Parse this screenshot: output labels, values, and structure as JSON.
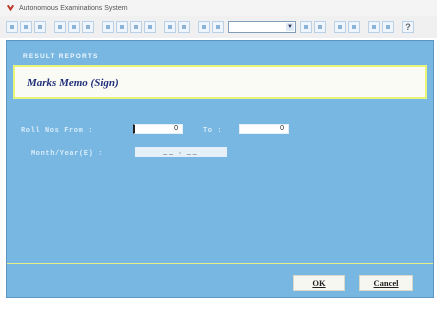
{
  "window": {
    "title": "Autonomous Examinations System"
  },
  "toolbar": {
    "combo_value": "",
    "help_label": "?"
  },
  "form": {
    "section_label": "RESULT REPORTS",
    "title": "Marks Memo (Sign)",
    "roll_label": "Roll Nos From :",
    "roll_from_value": "0",
    "to_label": "To :",
    "roll_to_value": "0",
    "month_year_label": "Month/Year(E) :",
    "month_year_value": "__ , __"
  },
  "buttons": {
    "ok_label": "OK",
    "cancel_label": "Cancel"
  },
  "colors": {
    "form_background": "#78b7e2",
    "accent_line": "#e4ee86",
    "title_color": "#20307a"
  }
}
